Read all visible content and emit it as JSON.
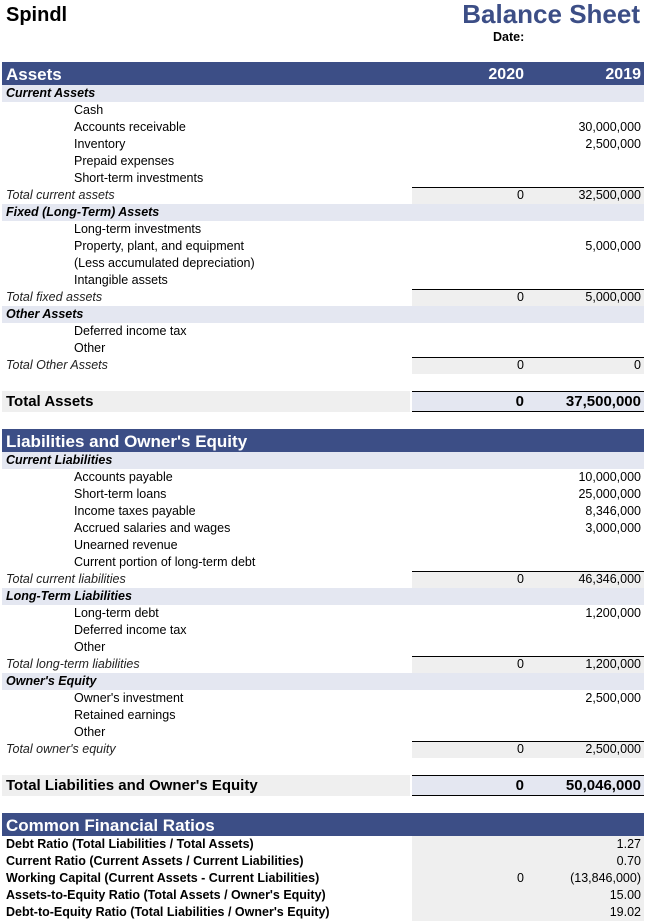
{
  "header": {
    "company": "Spindl",
    "title": "Balance Sheet",
    "date_label": "Date:"
  },
  "assets": {
    "heading": "Assets",
    "years": [
      "2020",
      "2019"
    ],
    "current": {
      "label": "Current Assets",
      "items": [
        {
          "label": "Cash",
          "v2020": "",
          "v2019": ""
        },
        {
          "label": "Accounts receivable",
          "v2020": "",
          "v2019": "30,000,000"
        },
        {
          "label": "Inventory",
          "v2020": "",
          "v2019": "2,500,000"
        },
        {
          "label": "Prepaid expenses",
          "v2020": "",
          "v2019": ""
        },
        {
          "label": "Short-term investments",
          "v2020": "",
          "v2019": ""
        }
      ],
      "total": {
        "label": "Total current assets",
        "v2020": "0",
        "v2019": "32,500,000"
      }
    },
    "fixed": {
      "label": "Fixed (Long-Term) Assets",
      "items": [
        {
          "label": "Long-term investments",
          "v2020": "",
          "v2019": ""
        },
        {
          "label": "Property, plant, and equipment",
          "v2020": "",
          "v2019": "5,000,000"
        },
        {
          "label": "(Less accumulated depreciation)",
          "v2020": "",
          "v2019": ""
        },
        {
          "label": "Intangible assets",
          "v2020": "",
          "v2019": ""
        }
      ],
      "total": {
        "label": "Total fixed assets",
        "v2020": "0",
        "v2019": "5,000,000"
      }
    },
    "other": {
      "label": "Other Assets",
      "items": [
        {
          "label": "Deferred income tax",
          "v2020": "",
          "v2019": ""
        },
        {
          "label": "Other",
          "v2020": "",
          "v2019": ""
        }
      ],
      "total": {
        "label": "Total Other Assets",
        "v2020": "0",
        "v2019": "0"
      }
    },
    "grand_total": {
      "label": "Total Assets",
      "v2020": "0",
      "v2019": "37,500,000"
    }
  },
  "liabilities": {
    "heading": "Liabilities and Owner's Equity",
    "current": {
      "label": "Current Liabilities",
      "items": [
        {
          "label": "Accounts payable",
          "v2020": "",
          "v2019": "10,000,000"
        },
        {
          "label": "Short-term loans",
          "v2020": "",
          "v2019": "25,000,000"
        },
        {
          "label": "Income taxes payable",
          "v2020": "",
          "v2019": "8,346,000"
        },
        {
          "label": "Accrued salaries and wages",
          "v2020": "",
          "v2019": "3,000,000"
        },
        {
          "label": "Unearned revenue",
          "v2020": "",
          "v2019": ""
        },
        {
          "label": "Current portion of long-term debt",
          "v2020": "",
          "v2019": ""
        }
      ],
      "total": {
        "label": "Total current liabilities",
        "v2020": "0",
        "v2019": "46,346,000"
      }
    },
    "longterm": {
      "label": "Long-Term Liabilities",
      "items": [
        {
          "label": "Long-term debt",
          "v2020": "",
          "v2019": "1,200,000"
        },
        {
          "label": "Deferred income tax",
          "v2020": "",
          "v2019": ""
        },
        {
          "label": "Other",
          "v2020": "",
          "v2019": ""
        }
      ],
      "total": {
        "label": "Total long-term liabilities",
        "v2020": "0",
        "v2019": "1,200,000"
      }
    },
    "equity": {
      "label": "Owner's Equity",
      "items": [
        {
          "label": "Owner's investment",
          "v2020": "",
          "v2019": "2,500,000"
        },
        {
          "label": "Retained earnings",
          "v2020": "",
          "v2019": ""
        },
        {
          "label": "Other",
          "v2020": "",
          "v2019": ""
        }
      ],
      "total": {
        "label": "Total owner's equity",
        "v2020": "0",
        "v2019": "2,500,000"
      }
    },
    "grand_total": {
      "label": "Total Liabilities and Owner's Equity",
      "v2020": "0",
      "v2019": "50,046,000"
    }
  },
  "ratios": {
    "heading": "Common Financial Ratios",
    "items": [
      {
        "label": "Debt Ratio (Total Liabilities / Total Assets)",
        "v2020": "",
        "v2019": "1.27"
      },
      {
        "label": "Current Ratio (Current Assets / Current Liabilities)",
        "v2020": "",
        "v2019": "0.70"
      },
      {
        "label": "Working Capital (Current Assets - Current Liabilities)",
        "v2020": "0",
        "v2019": "(13,846,000)"
      },
      {
        "label": "Assets-to-Equity Ratio (Total Assets / Owner's Equity)",
        "v2020": "",
        "v2019": "15.00"
      },
      {
        "label": "Debt-to-Equity Ratio (Total Liabilities / Owner's Equity)",
        "v2020": "",
        "v2019": "19.02"
      }
    ]
  },
  "colors": {
    "header_bg": "#3c4e86",
    "subheader_bg": "#e4e7f1",
    "total_bg": "#efefef"
  }
}
